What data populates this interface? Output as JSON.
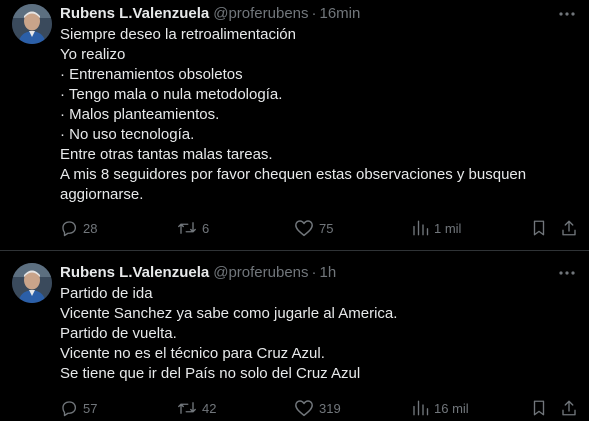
{
  "colors": {
    "background": "#000000",
    "primary_text": "#e7e9ea",
    "secondary_text": "#71767b",
    "divider": "#2f3336"
  },
  "tweets": [
    {
      "author_name": "Rubens L.Valenzuela",
      "handle": "@proferubens",
      "separator": "·",
      "time": "16min",
      "lines": [
        "Siempre deseo la retroalimentación",
        "Yo realizo",
        "· Entrenamientos obsoletos",
        "· Tengo mala o nula metodología.",
        "· Malos planteamientos.",
        "· No uso tecnología.",
        "Entre otras tantas malas tareas.",
        "A mis 8 seguidores por favor chequen estas observaciones y busquen",
        "aggiornarse."
      ],
      "replies": "28",
      "retweets": "6",
      "likes": "75",
      "views": "1 mil",
      "icons": [
        "avatar-photo",
        "more-icon",
        "reply-icon",
        "retweet-icon",
        "like-icon",
        "views-icon",
        "bookmark-icon",
        "share-icon"
      ]
    },
    {
      "author_name": "Rubens L.Valenzuela",
      "handle": "@proferubens",
      "separator": "·",
      "time": "1h",
      "lines": [
        "Partido de ida",
        "Vicente Sanchez ya sabe como jugarle al America.",
        "Partido de vuelta.",
        "Vicente no es el técnico para Cruz Azul.",
        "Se tiene que ir del País no solo del Cruz Azul"
      ],
      "replies": "57",
      "retweets": "42",
      "likes": "319",
      "views": "16 mil",
      "icons": [
        "avatar-photo",
        "more-icon",
        "reply-icon",
        "retweet-icon",
        "like-icon",
        "views-icon",
        "bookmark-icon",
        "share-icon"
      ]
    }
  ]
}
